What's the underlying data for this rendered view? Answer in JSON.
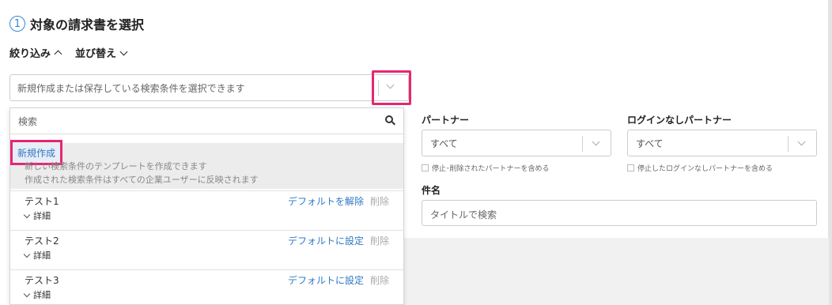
{
  "section": {
    "step_number": "1",
    "title": "対象の請求書を選択"
  },
  "toolbar": {
    "filter_label": "絞り込み",
    "sort_label": "並び替え"
  },
  "condition_select": {
    "placeholder": "新規作成または保存している検索条件を選択できます"
  },
  "dropdown": {
    "search_placeholder": "検索",
    "new_label": "新規作成",
    "new_desc_1": "新しい検索条件のテンプレートを作成できます",
    "new_desc_2": "作成された検索条件はすべての企業ユーザーに反映されます",
    "items": [
      {
        "name": "テスト1",
        "detail": "詳細",
        "default_action": "デフォルトを解除",
        "delete": "削除"
      },
      {
        "name": "テスト2",
        "detail": "詳細",
        "default_action": "デフォルトに設定",
        "delete": "削除"
      },
      {
        "name": "テスト3",
        "detail": "詳細",
        "default_action": "デフォルトに設定",
        "delete": "削除"
      }
    ]
  },
  "filters": {
    "partner_label": "パートナー",
    "partner_value": "すべて",
    "partner_checkbox": "停止･削除されたパートナーを含める",
    "nologin_label": "ログインなしパートナー",
    "nologin_value": "すべて",
    "nologin_checkbox": "停止したログインなしパートナーを含める",
    "subject_label": "件名",
    "subject_placeholder": "タイトルで検索"
  },
  "colors": {
    "accent": "#2f78c4",
    "highlight": "#e5286f"
  }
}
